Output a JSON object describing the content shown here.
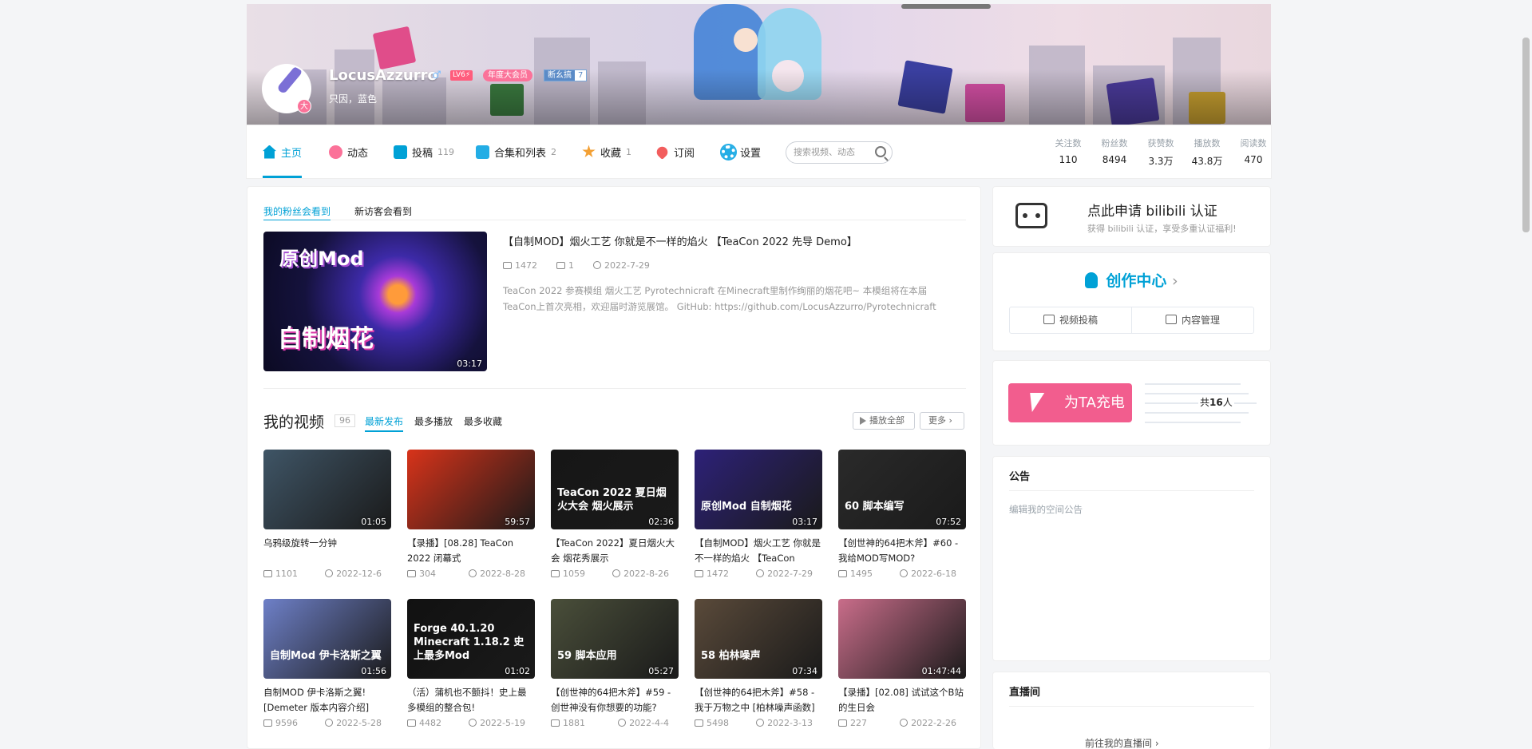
{
  "profile": {
    "username": "LocusAzzurro",
    "sex_icon": "♂",
    "level": "LV6⚡",
    "vip": "年度大会员",
    "medal_name": "断幺搞",
    "medal_level": "7",
    "avatar_badge": "大",
    "sign": "只因，蓝色"
  },
  "nav": {
    "items": [
      {
        "label": "主页",
        "count": "",
        "icon": "home-icon",
        "color": "#00a1d6"
      },
      {
        "label": "动态",
        "count": "",
        "icon": "dynamic-icon",
        "color": "#fb7299"
      },
      {
        "label": "投稿",
        "count": "119",
        "icon": "upload-icon",
        "color": "#00a1d6"
      },
      {
        "label": "合集和列表",
        "count": "2",
        "icon": "collection-icon",
        "color": "#23ade5"
      },
      {
        "label": "收藏",
        "count": "1",
        "icon": "star-icon",
        "color": "#f3a034"
      },
      {
        "label": "订阅",
        "count": "",
        "icon": "heart-icon",
        "color": "#f25d5d"
      },
      {
        "label": "设置",
        "count": "",
        "icon": "gear-icon",
        "color": "#23ade5"
      }
    ],
    "search_placeholder": "搜索视频、动态",
    "stats": [
      {
        "label": "关注数",
        "value": "110"
      },
      {
        "label": "粉丝数",
        "value": "8494"
      },
      {
        "label": "获赞数",
        "value": "3.3万"
      },
      {
        "label": "播放数",
        "value": "43.8万"
      },
      {
        "label": "阅读数",
        "value": "470"
      }
    ]
  },
  "featured": {
    "tab_fans": "我的粉丝会看到",
    "tab_visitors": "新访客会看到",
    "cover_text_top": "原创Mod",
    "cover_text_bottom": "自制烟花",
    "duration": "03:17",
    "title": "【自制MOD】烟火工艺 你就是不一样的焰火 【TeaCon 2022 先导 Demo】",
    "plays": "1472",
    "comments": "1",
    "date": "2022-7-29",
    "description": "TeaCon 2022 参赛模组 烟火工艺 Pyrotechnicraft 在Minecraft里制作绚丽的烟花吧~ 本模组将在本届TeaCon上首次亮相，欢迎届时游览展馆。 GitHub: https://github.com/LocusAzzurro/Pyrotechnicraft"
  },
  "videos_section": {
    "heading": "我的视频",
    "count": "96",
    "tabs": [
      "最新发布",
      "最多播放",
      "最多收藏"
    ],
    "play_all": "播放全部",
    "more": "更多 ›"
  },
  "videos": [
    {
      "title": "乌鸦级旋转一分钟",
      "duration": "01:05",
      "plays": "1101",
      "date": "2022-12-6",
      "overlay": "",
      "color": "#3f5566"
    },
    {
      "title": "【录播】[08.28] TeaCon 2022 闭幕式",
      "duration": "59:57",
      "plays": "304",
      "date": "2022-8-28",
      "overlay": "",
      "color": "#d8331a"
    },
    {
      "title": "【TeaCon 2022】夏日烟火大会 烟花秀展示",
      "duration": "02:36",
      "plays": "1059",
      "date": "2022-8-26",
      "overlay": "TeaCon 2022 夏日烟火大会 烟火展示",
      "color": "#161616"
    },
    {
      "title": "【自制MOD】烟火工艺 你就是不一样的焰火 【TeaCon",
      "duration": "03:17",
      "plays": "1472",
      "date": "2022-7-29",
      "overlay": "原创Mod 自制烟花",
      "color": "#2d2178"
    },
    {
      "title": "【创世神的64把木斧】#60 - 我给MOD写MOD?",
      "duration": "07:52",
      "plays": "1495",
      "date": "2022-6-18",
      "overlay": "60 脚本编写",
      "color": "#2a2a2a"
    },
    {
      "title": "自制MOD 伊卡洛斯之翼! [Demeter 版本内容介绍]",
      "duration": "01:56",
      "plays": "9596",
      "date": "2022-5-28",
      "overlay": "自制Mod 伊卡洛斯之翼",
      "color": "#6e80c8"
    },
    {
      "title": "（活）蒲机也不颤抖！史上最多模组的整合包!",
      "duration": "01:02",
      "plays": "4482",
      "date": "2022-5-19",
      "overlay": "Forge 40.1.20 Minecraft 1.18.2 史上最多Mod",
      "color": "#111111"
    },
    {
      "title": "【创世神的64把木斧】#59 - 创世神没有你想要的功能?",
      "duration": "05:27",
      "plays": "1881",
      "date": "2022-4-4",
      "overlay": "59 脚本应用",
      "color": "#4a4f3a"
    },
    {
      "title": "【创世神的64把木斧】#58 - 我于万物之中 [柏林噪声函数]",
      "duration": "07:34",
      "plays": "5498",
      "date": "2022-3-13",
      "overlay": "58 柏林噪声",
      "color": "#5a4a3a"
    },
    {
      "title": "【录播】[02.08] 试试这个B站的生日会",
      "duration": "01:47:44",
      "plays": "227",
      "date": "2022-2-26",
      "overlay": "",
      "color": "#c96d8a"
    }
  ],
  "sidebar": {
    "auth_title": "点此申请 bilibili 认证",
    "auth_sub": "获得 bilibili 认证，享受多重认证福利!",
    "creator_center": "创作中心",
    "upload_label": "视频投稿",
    "manage_label": "内容管理",
    "charge_label": "为TA充电",
    "charge_prefix": "共",
    "charge_count": "16",
    "charge_suffix": "人",
    "notice_title": "公告",
    "notice_placeholder": "编辑我的空间公告",
    "live_title": "直播间",
    "live_link": "前往我的直播间 ›"
  }
}
